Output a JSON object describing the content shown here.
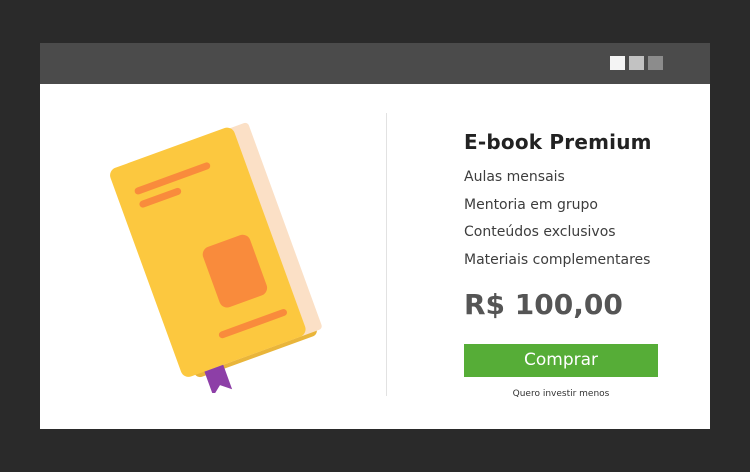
{
  "window": {
    "controls": [
      {
        "name": "window-control-1",
        "color": "#f4f4f4"
      },
      {
        "name": "window-control-2",
        "color": "#c2c2c2"
      },
      {
        "name": "window-control-3",
        "color": "#8c8c8c"
      }
    ]
  },
  "illustration": {
    "icon": "book-icon",
    "colors": {
      "cover": "#fcc83f",
      "pages": "#fbe0c6",
      "accent": "#f98b3c",
      "bookmark": "#8d3fa7"
    }
  },
  "product": {
    "title": "E-book Premium",
    "features": [
      "Aulas mensais",
      "Mentoria em grupo",
      "Conteúdos exclusivos",
      "Materiais complementares"
    ],
    "price": "R$ 100,00"
  },
  "actions": {
    "buy_label": "Comprar",
    "buy_color": "#56ad37",
    "less_label": "Quero investir menos"
  },
  "colors": {
    "background": "#2a2a2a",
    "titlebar": "#4b4b4b",
    "card": "#ffffff"
  }
}
